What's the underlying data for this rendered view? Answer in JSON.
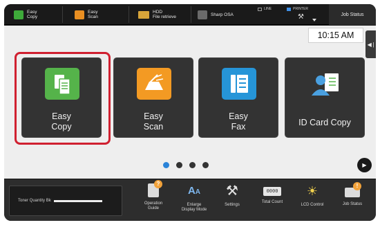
{
  "topbar": {
    "shortcuts": [
      {
        "label": "Easy\nCopy",
        "icon": "easy-copy-icon"
      },
      {
        "label": "Easy\nScan",
        "icon": "easy-scan-icon"
      },
      {
        "label": "HDD\nFile retrieve",
        "icon": "folder-icon"
      },
      {
        "label": "Sharp OSA",
        "icon": "osa-icon"
      }
    ],
    "status": {
      "line": "LINE",
      "printer": "PRINTER"
    },
    "job_status": "Job Status"
  },
  "main": {
    "time": "10:15 AM",
    "tiles": [
      {
        "label": "Easy\nCopy",
        "selected": true
      },
      {
        "label": "Easy\nScan"
      },
      {
        "label": "Easy\nFax"
      },
      {
        "label": "ID Card Copy"
      }
    ],
    "page_indicator": {
      "pages": 4,
      "current": 1
    }
  },
  "bottombar": {
    "toner_label": "Toner Quantity  Bk",
    "items": [
      {
        "label": "Operation\nGuide",
        "icon": "operation-guide-icon"
      },
      {
        "label": "Enlarge\nDisplay Mode",
        "icon": "enlarge-display-icon"
      },
      {
        "label": "Settings",
        "icon": "settings-icon"
      },
      {
        "label": "Total Count",
        "icon": "counter-icon"
      },
      {
        "label": "LCD Control",
        "icon": "brightness-icon"
      },
      {
        "label": "Job Status",
        "icon": "job-status-icon"
      }
    ]
  },
  "colors": {
    "highlight": "#d02030",
    "accent_blue": "#2a83d8",
    "easy_copy_green": "#55b34a",
    "easy_scan_orange": "#f39a23",
    "easy_fax_blue": "#2695d8"
  }
}
